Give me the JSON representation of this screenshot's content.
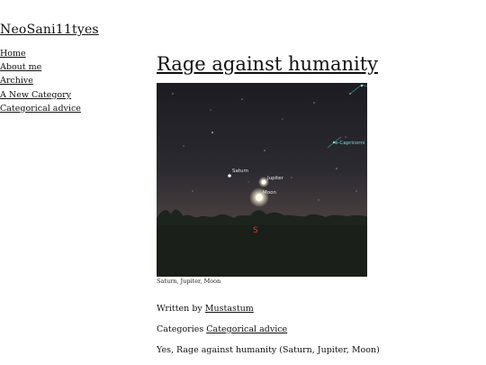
{
  "site": {
    "title": "NeoSani11tyes"
  },
  "nav": [
    {
      "label": "Home"
    },
    {
      "label": "About me"
    },
    {
      "label": "Archive"
    },
    {
      "label": "A New Category"
    },
    {
      "label": "Categorical advice"
    }
  ],
  "post": {
    "title": "Rage against humanity",
    "image": {
      "labels": {
        "saturn": "Saturn",
        "jupiter": "Jupiter",
        "moon": "Moon",
        "capricorn": "e-Capricorni",
        "south": "S"
      },
      "caption": "Saturn, Jupiter, Moon"
    },
    "byline": {
      "prefix": "Written by",
      "author": "Mustastum"
    },
    "categories": {
      "prefix": "Categories",
      "link": "Categorical advice"
    },
    "body": "Yes, Rage against humanity (Saturn, Jupiter, Moon)"
  }
}
